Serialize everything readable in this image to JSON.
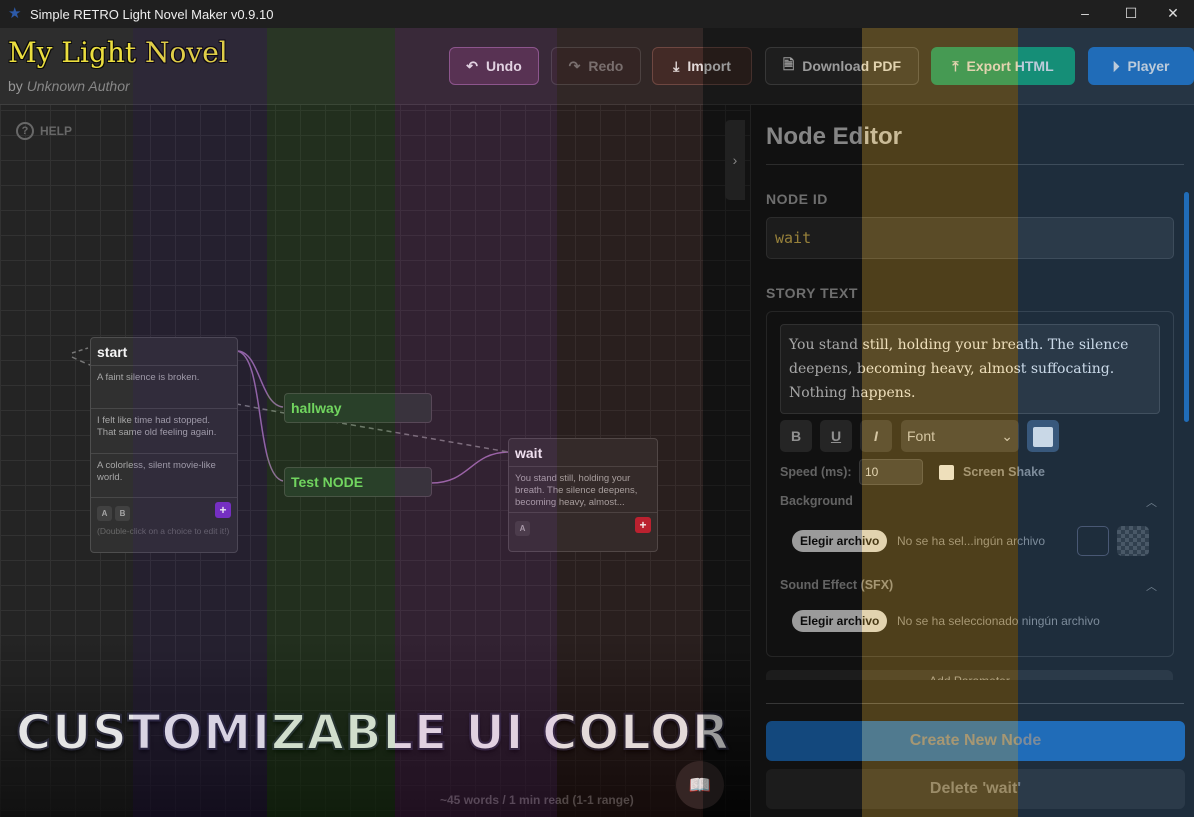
{
  "window": {
    "title": "Simple RETRO Light Novel Maker v0.9.10",
    "controls": [
      "minimize",
      "maximize",
      "close"
    ]
  },
  "header": {
    "title": "My Light Novel",
    "by": "by",
    "author": "Unknown Author",
    "buttons": {
      "undo": "Undo",
      "redo": "Redo",
      "import": "Import",
      "download_pdf": "Download PDF",
      "export_html": "Export HTML",
      "player": "Player"
    }
  },
  "canvas": {
    "help": "HELP",
    "nodes": {
      "start": {
        "title": "start",
        "choices": [
          "A faint silence is broken.",
          "I felt like time had stopped. That same old feeling again.",
          "A colorless, silent movie-like world."
        ],
        "tabs": [
          "A",
          "B"
        ],
        "hint": "(Double-click on a choice to edit it!)"
      },
      "hallway": {
        "title": "hallway"
      },
      "test": {
        "title": "Test NODE"
      },
      "wait": {
        "title": "wait",
        "text": "You stand still, holding your breath. The silence deepens, becoming heavy, almost...",
        "tabs": [
          "A"
        ]
      }
    },
    "banner": "CUSTOMIZABLE UI COLOR",
    "word_count": "~45 words / 1 min read (1-1 range)"
  },
  "panel": {
    "title": "Node Editor",
    "node_id_label": "NODE ID",
    "node_id": "wait",
    "story_label": "STORY TEXT",
    "story_text": "You stand still, holding your breath. The silence deepens, becoming heavy, almost suffocating. Nothing happens.",
    "format": {
      "bold": "B",
      "underline": "U",
      "italic": "I",
      "font": "Font"
    },
    "speed_label": "Speed (ms):",
    "speed": "10",
    "shake_label": "Screen Shake",
    "shake_checked": false,
    "background_label": "Background",
    "file_button": "Elegir archivo",
    "bg_file": "No se ha sel...ingún archivo",
    "sfx_label": "Sound Effect (SFX)",
    "sfx_file": "No se ha seleccionado ningún archivo",
    "add_param": "Add Parameter",
    "create": "Create New Node",
    "delete": "Delete 'wait'"
  },
  "colors": {
    "accent_green": "#0f9d6a",
    "accent_blue": "#1e6fc0",
    "title_yellow": "#f5e63a",
    "stripes": [
      "#808080",
      "#5a3ca0",
      "#3c8c28",
      "#a03ca0",
      "#963228",
      "#000000",
      "#c8961e",
      "#28649f"
    ]
  }
}
